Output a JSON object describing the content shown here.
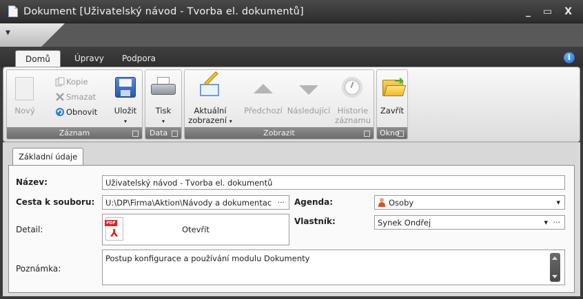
{
  "window": {
    "title": "Dokument [Uživatelský návod - Tvorba el. dokumentů]",
    "minimize": "_",
    "maximize": "▭",
    "close": "X"
  },
  "qat": {
    "dropdown": "▼"
  },
  "ribbon": {
    "tabs": [
      {
        "label": "Domů",
        "active": true
      },
      {
        "label": "Úpravy",
        "active": false
      },
      {
        "label": "Podpora",
        "active": false
      }
    ],
    "info": "i",
    "groups": {
      "zaznam": {
        "label": "Záznam",
        "novy": "Nový",
        "kopie": "Kopie",
        "smazat": "Smazat",
        "obnovit": "Obnovit",
        "ulozit": "Uložit"
      },
      "data": {
        "label": "Data",
        "tisk": "Tisk"
      },
      "zobrazit": {
        "label": "Zobrazit",
        "aktualni_1": "Aktuální",
        "aktualni_2": "zobrazení",
        "predchozi": "Předchozí",
        "nasledujici": "Následující",
        "historie_1": "Historie",
        "historie_2": "záznamu"
      },
      "okno": {
        "label": "Okno",
        "zavrit": "Zavřít"
      }
    }
  },
  "form": {
    "tab": "Základní údaje",
    "nazev_label": "Název:",
    "nazev_value": "Uživatelský návod - Tvorba el. dokumentů",
    "cesta_label": "Cesta k souboru:",
    "cesta_value": "U:\\DP\\Firma\\Aktion\\Návody a dokumentac",
    "ellipsis": "···",
    "agenda_label": "Agenda:",
    "agenda_value": "Osoby",
    "detail_label": "Detail:",
    "pdf_tag": "PDF",
    "otevrit": "Otevřít",
    "vlastnik_label": "Vlastník:",
    "vlastnik_value": "Synek Ondřej",
    "poznamka_label": "Poznámka:",
    "poznamka_value": "Postup konfigurace a používání modulu Dokumenty",
    "dropdown_arrow": "▾"
  }
}
